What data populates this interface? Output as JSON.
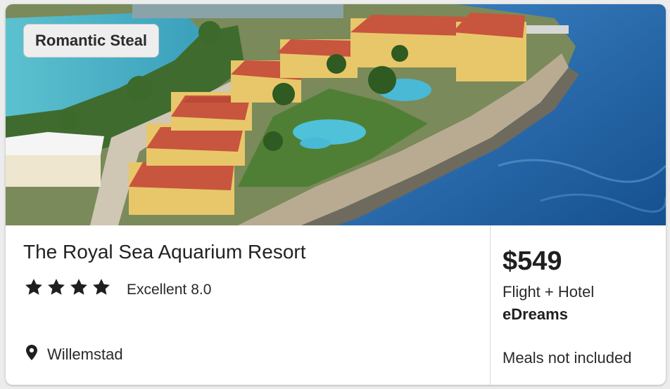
{
  "card": {
    "image_alt": "Aerial view of resort on seafront peninsula",
    "badge": "Romantic Steal",
    "hotel_name": "The Royal Sea Aquarium Resort",
    "star_count": 4,
    "rating_label": "Excellent",
    "rating_score": "8.0",
    "location": "Willemstad",
    "price": "$549",
    "package": "Flight + Hotel",
    "provider": "eDreams",
    "meals": "Meals not included"
  },
  "icons": {
    "star": "star-icon",
    "location": "map-pin-icon"
  },
  "colors": {
    "sea_deep": "#1f5fa6",
    "lagoon": "#4fb8c8",
    "roof": "#c8553d",
    "wall": "#e8c76a"
  }
}
